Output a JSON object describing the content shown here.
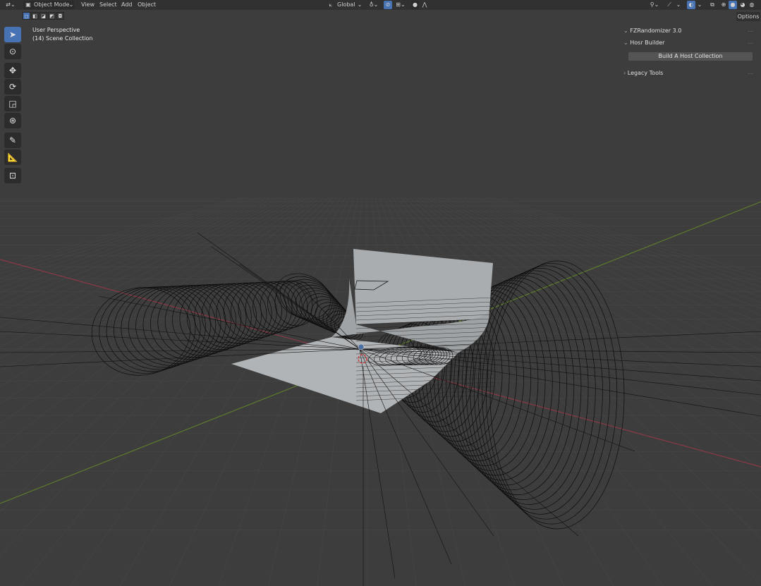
{
  "header": {
    "mode_label": "Object Mode",
    "menus": [
      "View",
      "Select",
      "Add",
      "Object"
    ],
    "orientation_label": "Global",
    "editor_type_icon": "editor-type-icon",
    "snap_icon": "snap-icon",
    "proportional_icon": "proportional-edit-icon",
    "gizmo_icon": "gizmo-icon",
    "overlay_icon": "overlay-icon",
    "xray_icon": "xray-icon",
    "shading_icons": [
      "wireframe-shading-icon",
      "solid-shading-icon",
      "material-shading-icon",
      "rendered-shading-icon"
    ]
  },
  "viewport": {
    "perspective_label": "User Perspective",
    "collection_label": "(14) Scene Collection",
    "options_label": "Options"
  },
  "toolbar": {
    "tools": [
      "select-box-icon",
      "cursor-icon",
      "move-icon",
      "rotate-icon",
      "scale-icon",
      "transform-icon",
      "annotate-icon",
      "measure-icon",
      "add-cube-icon"
    ],
    "active_tool": "select-box-icon"
  },
  "panel": {
    "addon_title": "FZRandomizer 3.0",
    "section_title": "Hosr Builder",
    "build_button": "Build A Host Collection",
    "legacy_title": "Legacy Tools"
  },
  "colors": {
    "background": "#3d3d3d",
    "x_axis": "#8b3a45",
    "y_axis": "#5d7d2c",
    "active_blue": "#4772b3",
    "plane": "#a9adaf"
  }
}
